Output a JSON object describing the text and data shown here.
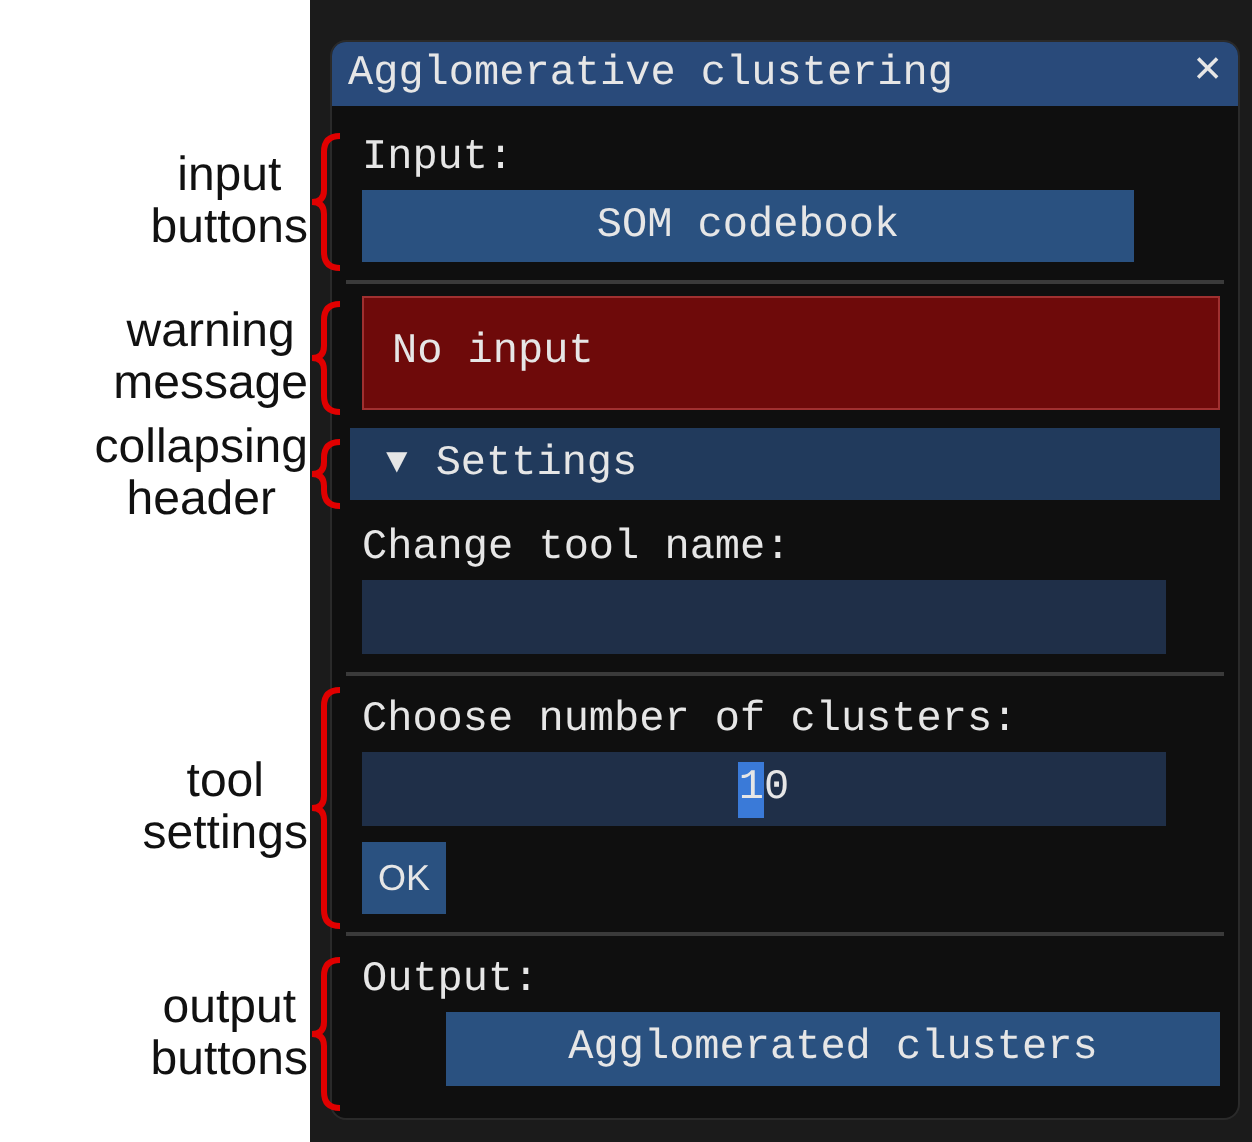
{
  "annotations": [
    {
      "lines": [
        "input",
        "buttons"
      ]
    },
    {
      "lines": [
        "warning",
        "message"
      ]
    },
    {
      "lines": [
        "collapsing",
        "header"
      ]
    },
    {
      "lines": [
        "tool",
        "settings"
      ]
    },
    {
      "lines": [
        "output",
        "buttons"
      ]
    }
  ],
  "window": {
    "title": "Agglomerative clustering",
    "close": "×"
  },
  "input": {
    "label": "Input:",
    "button": "SOM codebook"
  },
  "warning": {
    "text": "No input"
  },
  "settings": {
    "arrow": "▼",
    "label": "Settings",
    "expanded": true,
    "name_label": "Change tool name:",
    "clusters_label": "Choose number of clusters:",
    "clusters_selected": "1",
    "clusters_rest": "0",
    "ok": "OK"
  },
  "output": {
    "label": "Output:",
    "button": "Agglomerated clusters"
  }
}
